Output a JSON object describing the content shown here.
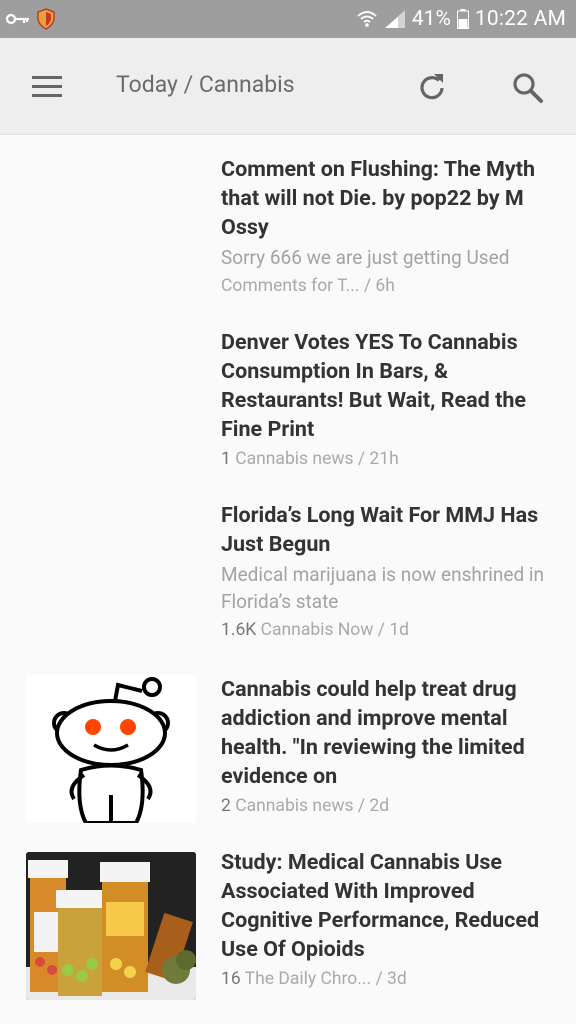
{
  "status_bar": {
    "battery_percent": "41%",
    "time": "10:22 AM",
    "icons": [
      "key-icon",
      "shield-icon",
      "wifi-icon",
      "signal-icon",
      "battery-icon"
    ]
  },
  "app_bar": {
    "title": "Today / Cannabis",
    "icons": [
      "menu-icon",
      "refresh-icon",
      "search-icon"
    ]
  },
  "articles": [
    {
      "headline": "Comment on Flushing: The Myth that will not Die. by pop22 by M Ossy",
      "summary": "Sorry 666 we are just getting Used",
      "count": "",
      "source": "Comments for T... / 6h"
    },
    {
      "headline": "Denver Votes YES To Cannabis Consumption In Bars, & Restaurants! But Wait, Read the Fine Print",
      "summary": "",
      "count": "1",
      "source": "Cannabis news / 21h"
    },
    {
      "headline": "Florida’s Long Wait For MMJ Has Just Begun",
      "summary": "Medical marijuana is now enshrined in Florida’s state",
      "count": "1.6K",
      "source": "Cannabis Now / 1d"
    },
    {
      "headline": "Cannabis could help treat drug addiction and improve mental health. \"In reviewing the limited evidence on",
      "summary": "",
      "count": "2",
      "source": "Cannabis news / 2d",
      "thumbnail": "reddit-alien-icon"
    },
    {
      "headline": "Study: Medical Cannabis Use Associated With Improved Cognitive Performance, Reduced Use Of Opioids",
      "summary": "",
      "count": "16",
      "source": "The Daily Chro... / 3d",
      "thumbnail": "pill-bottles-image"
    }
  ]
}
